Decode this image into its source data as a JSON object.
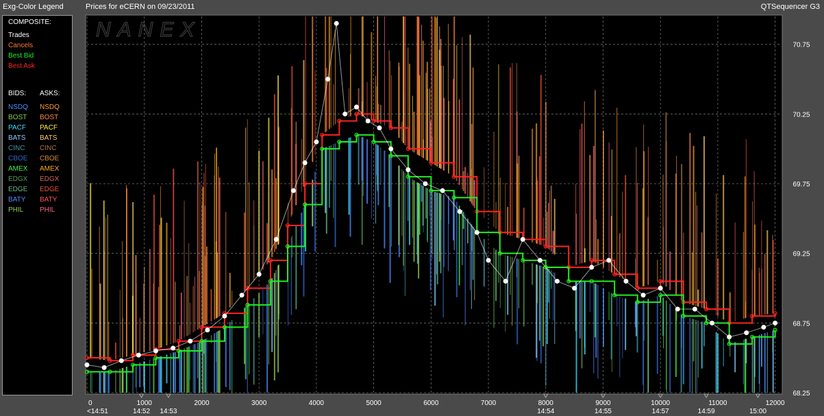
{
  "window": {
    "legend_title": "Exg-Color Legend",
    "chart_title": "Prices for  eCERN  on  09/23/2011",
    "app_name": "QTSequencer G3",
    "watermark": "NANEX"
  },
  "legend": {
    "composite_heading": "COMPOSITE:",
    "composite_items": [
      {
        "label": "Trades",
        "color": "#ffffff"
      },
      {
        "label": "Cancels",
        "color": "#ff7733"
      },
      {
        "label": "Best Bid",
        "color": "#22ee22"
      },
      {
        "label": "Best Ask",
        "color": "#ff2222"
      }
    ],
    "bids_heading": "BIDS:",
    "asks_heading": "ASKS:",
    "rows": [
      {
        "bid": "NSDQ",
        "bid_color": "#4a8cff",
        "ask": "NSDQ",
        "ask_color": "#ff9a2a"
      },
      {
        "bid": "BOST",
        "bid_color": "#88cc44",
        "ask": "BOST",
        "ask_color": "#ff8844"
      },
      {
        "bid": "PACF",
        "bid_color": "#44ddff",
        "ask": "PACF",
        "ask_color": "#ffee44"
      },
      {
        "bid": "BATS",
        "bid_color": "#88ccff",
        "ask": "BATS",
        "ask_color": "#ffcc66"
      },
      {
        "bid": "CINC",
        "bid_color": "#4499aa",
        "ask": "CINC",
        "ask_color": "#aa7744"
      },
      {
        "bid": "CBOE",
        "bid_color": "#3366cc",
        "ask": "CBOE",
        "ask_color": "#dd8833"
      },
      {
        "bid": "AMEX",
        "bid_color": "#44ee44",
        "ask": "AMEX",
        "ask_color": "#ffaa22"
      },
      {
        "bid": "EDGX",
        "bid_color": "#559955",
        "ask": "EDGX",
        "ask_color": "#cc6655"
      },
      {
        "bid": "EDGE",
        "bid_color": "#66bb88",
        "ask": "EDGE",
        "ask_color": "#ee5533"
      },
      {
        "bid": "BATY",
        "bid_color": "#5588ff",
        "ask": "BATY",
        "ask_color": "#ff5555"
      },
      {
        "bid": "PHIL",
        "bid_color": "#99cc55",
        "ask": "PHIL",
        "ask_color": "#ff6688"
      }
    ]
  },
  "chart_data": {
    "type": "line",
    "title": "Prices for  eCERN  on  09/23/2011",
    "xlim": [
      0,
      12100
    ],
    "ylim": [
      68.25,
      70.95
    ],
    "x_ticks": [
      0,
      1000,
      2000,
      3000,
      4000,
      5000,
      6000,
      7000,
      8000,
      9000,
      10000,
      11000,
      12000
    ],
    "x_tick_labels": [
      "0",
      "1000",
      "2000",
      "3000",
      "4000",
      "5000",
      "6000",
      "7000",
      "8000",
      "9000",
      "10000",
      "11000",
      "12000"
    ],
    "time_labels": [
      {
        "x": 0,
        "label": "<14:51"
      },
      {
        "x": 950,
        "label": "14:52"
      },
      {
        "x": 1420,
        "label": "14:53"
      },
      {
        "x": 8000,
        "label": "14:54"
      },
      {
        "x": 9000,
        "label": "14:55"
      },
      {
        "x": 10000,
        "label": "14:57"
      },
      {
        "x": 10800,
        "label": "14:59"
      },
      {
        "x": 11700,
        "label": "15:00"
      }
    ],
    "y_ticks": [
      68.25,
      68.75,
      69.25,
      69.75,
      70.25,
      70.75
    ],
    "y_tick_labels": [
      "68.25",
      "68.75",
      "69.25",
      "69.75",
      "70.25",
      "70.75"
    ],
    "grid": true,
    "series": [
      {
        "name": "Trades",
        "color": "#ffffff",
        "x": [
          0,
          300,
          600,
          900,
          1200,
          1500,
          1800,
          2100,
          2400,
          2700,
          3000,
          3300,
          3600,
          3800,
          4000,
          4200,
          4350,
          4500,
          4700,
          4900,
          5100,
          5300,
          5600,
          5900,
          6200,
          6500,
          6800,
          7000,
          7300,
          7600,
          7900,
          8200,
          8500,
          8800,
          9100,
          9400,
          9700,
          10000,
          10300,
          10600,
          10900,
          11200,
          11500,
          11800,
          12000
        ],
        "y": [
          68.45,
          68.43,
          68.48,
          68.52,
          68.55,
          68.57,
          68.62,
          68.7,
          68.8,
          68.95,
          69.1,
          69.35,
          69.7,
          69.9,
          70.05,
          70.5,
          70.9,
          70.25,
          70.3,
          70.2,
          70.15,
          70.0,
          69.85,
          69.75,
          69.7,
          69.55,
          69.4,
          69.2,
          69.05,
          69.35,
          69.2,
          69.05,
          69.0,
          69.15,
          69.2,
          69.05,
          68.95,
          69.0,
          68.85,
          68.85,
          68.75,
          68.65,
          68.68,
          68.72,
          68.75
        ]
      },
      {
        "name": "Best Bid",
        "color": "#22ee22",
        "x": [
          0,
          400,
          800,
          1200,
          1600,
          2000,
          2400,
          2800,
          3200,
          3500,
          3800,
          4100,
          4400,
          4700,
          5000,
          5300,
          5600,
          6000,
          6400,
          6800,
          7200,
          7600,
          8000,
          8400,
          8800,
          9200,
          9600,
          10000,
          10400,
          10800,
          11200,
          11600,
          12000
        ],
        "y": [
          68.4,
          68.4,
          68.45,
          68.5,
          68.55,
          68.62,
          68.72,
          68.88,
          69.05,
          69.3,
          69.6,
          70.0,
          70.05,
          70.1,
          70.05,
          69.95,
          69.8,
          69.7,
          69.65,
          69.4,
          69.25,
          69.2,
          69.15,
          69.05,
          69.05,
          68.95,
          68.9,
          68.95,
          68.8,
          68.75,
          68.6,
          68.65,
          68.7
        ]
      },
      {
        "name": "Best Ask",
        "color": "#ff2222",
        "x": [
          0,
          400,
          800,
          1200,
          1600,
          2000,
          2400,
          2800,
          3200,
          3500,
          3800,
          4100,
          4400,
          4700,
          5000,
          5300,
          5600,
          6000,
          6400,
          6800,
          7200,
          7600,
          8000,
          8400,
          8800,
          9200,
          9600,
          10000,
          10400,
          10800,
          11200,
          11600,
          12000
        ],
        "y": [
          68.5,
          68.48,
          68.52,
          68.56,
          68.62,
          68.72,
          68.82,
          69.0,
          69.2,
          69.45,
          69.75,
          70.1,
          70.2,
          70.25,
          70.2,
          70.15,
          70.0,
          69.9,
          69.8,
          69.55,
          69.4,
          69.35,
          69.3,
          69.15,
          69.2,
          69.1,
          69.0,
          69.05,
          68.9,
          68.85,
          68.75,
          68.8,
          68.82
        ]
      }
    ]
  }
}
